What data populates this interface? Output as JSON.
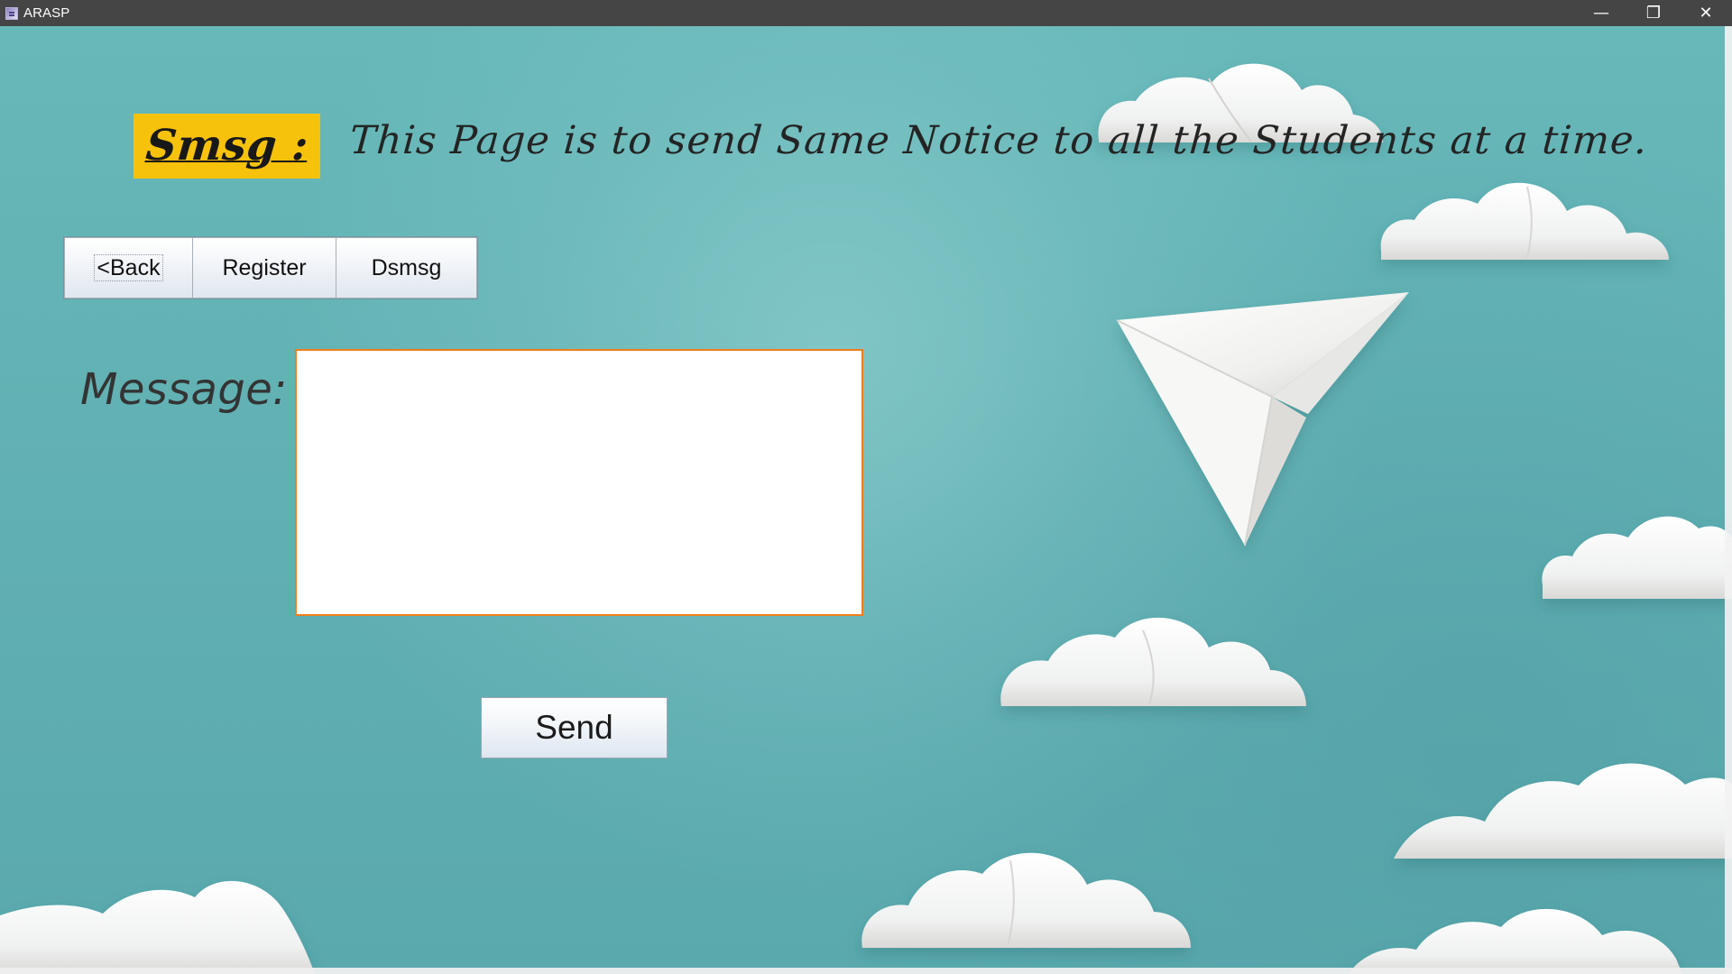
{
  "window": {
    "title": "ARASP",
    "controls": {
      "minimize": "—",
      "restore": "❐",
      "close": "✕"
    },
    "app_icon": "java-app-icon"
  },
  "header": {
    "badge_text": "Smsg :",
    "description": "This Page is to send Same Notice to all the Students at a time.",
    "badge_color": "#f7c20b"
  },
  "navigation": {
    "items": [
      {
        "label": "<Back"
      },
      {
        "label": "Register"
      },
      {
        "label": "Dsmsg"
      }
    ]
  },
  "form": {
    "message_label": "Message:",
    "message_value": "",
    "send_label": "Send"
  },
  "background": {
    "theme": "paper clouds and paper plane",
    "base_color": "#69b7b8"
  }
}
